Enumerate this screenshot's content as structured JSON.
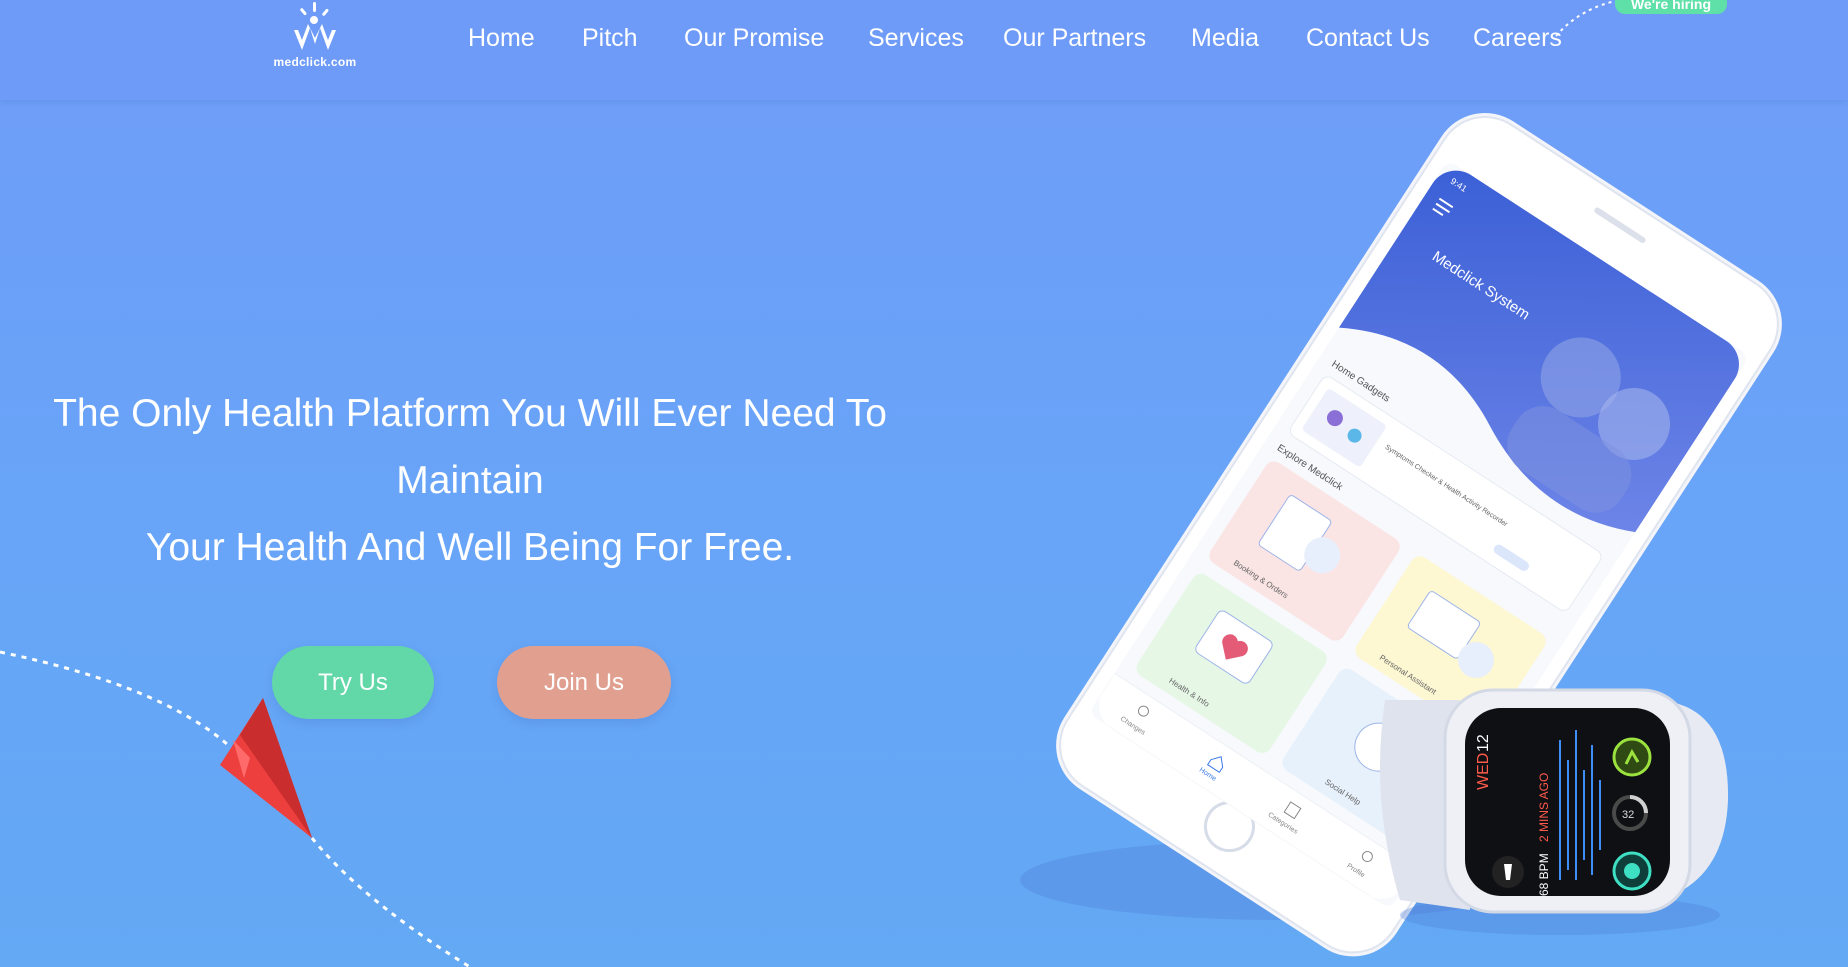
{
  "brand": {
    "logo_text": "medclick.com"
  },
  "nav": {
    "items": [
      {
        "label": "Home"
      },
      {
        "label": "Pitch"
      },
      {
        "label": "Our Promise"
      },
      {
        "label": "Services"
      },
      {
        "label": "Our Partners"
      },
      {
        "label": "Media"
      },
      {
        "label": "Contact Us"
      },
      {
        "label": "Careers"
      }
    ],
    "hiring_badge": "We're hiring"
  },
  "hero": {
    "line1": "The Only Health Platform You Will Ever Need To",
    "line2": "Maintain",
    "line3": "Your Health And Well Being For Free.",
    "try_label": "Try Us",
    "join_label": "Join Us"
  },
  "phone": {
    "time": "9:41",
    "banner_title": "Medclick System",
    "section_home_gadgets": "Home Gadgets",
    "gadget_text": "Symptoms Checker & Health Activity Recorder",
    "section_explore": "Explore Medclick",
    "tiles": [
      {
        "label": "Booking & Orders"
      },
      {
        "label": "Personal Assistant"
      },
      {
        "label": "Health & Info"
      },
      {
        "label": "Social Help"
      }
    ],
    "tabbar": [
      {
        "label": "Changes"
      },
      {
        "label": "Home"
      },
      {
        "label": "Categories"
      },
      {
        "label": "Profile"
      }
    ]
  },
  "watch": {
    "day": "WED",
    "date": "12",
    "ago": "2 MINS AGO",
    "bpm": "68 BPM",
    "ring_value": "32"
  },
  "colors": {
    "primary_blue": "#6e9bf7",
    "try_green": "#62d7a8",
    "join_salmon": "#e1a08f",
    "plane_red": "#ee3f3f"
  }
}
